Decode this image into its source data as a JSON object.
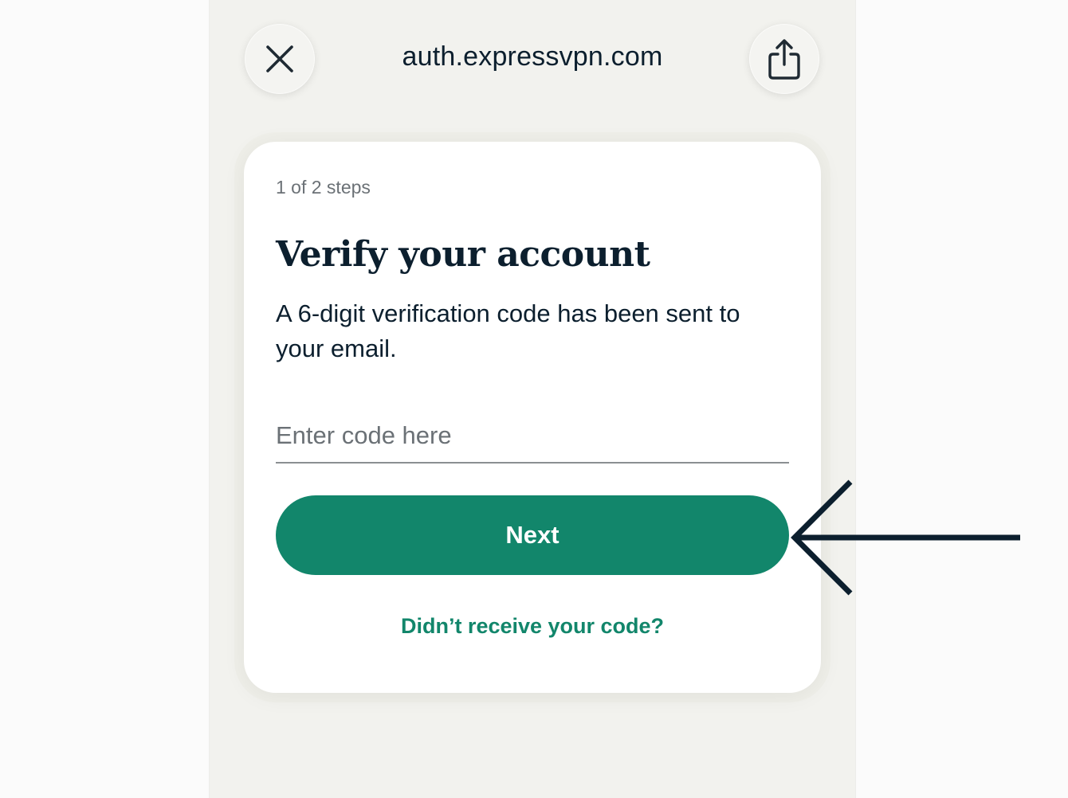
{
  "browser": {
    "url": "auth.expressvpn.com",
    "close_icon": "close-icon",
    "share_icon": "share-icon"
  },
  "verify_form": {
    "step_indicator": "1 of 2 steps",
    "title": "Verify your account",
    "description": "A 6-digit verification code has been sent to your email.",
    "code_placeholder": "Enter code here",
    "code_value": "",
    "next_label": "Next",
    "resend_link": "Didn’t receive your code?"
  },
  "annotation": {
    "arrow_icon": "arrow-left-icon",
    "arrow_color": "#0c1f2e"
  },
  "colors": {
    "accent": "#12866b",
    "text_dark": "#0c1f2e",
    "text_muted": "#6b7176",
    "page_bg": "#f2f2ee"
  }
}
